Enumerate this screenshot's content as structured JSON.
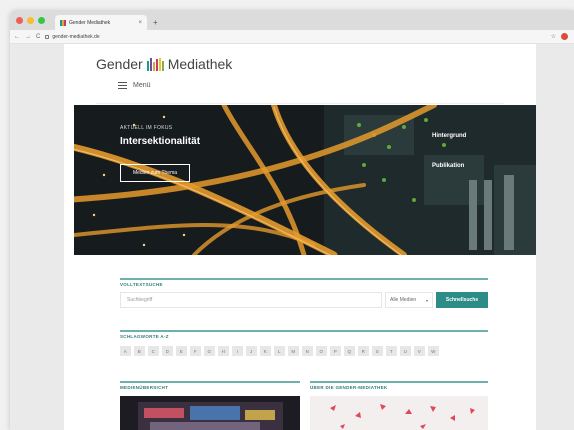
{
  "browser": {
    "tab_title": "Gender Mediathek",
    "tab_close": "×",
    "new_tab": "+",
    "url": "gender-mediathek.de",
    "nav_back": "←",
    "nav_forward": "→",
    "nav_reload": "C",
    "star": "☆",
    "traffic_lights": [
      "#ef5f57",
      "#f6bd2f",
      "#33c748"
    ]
  },
  "site": {
    "logo_left": "Gender",
    "logo_right": "Mediathek",
    "logo_bar_colors": [
      "#1c9a8f",
      "#6a4f9e",
      "#e8a03a",
      "#c0405c",
      "#f2c233",
      "#7cb342"
    ],
    "menu_label": "Menü"
  },
  "hero": {
    "kicker": "AKTUELL IM FOKUS",
    "title": "Intersektionalität",
    "button": "Medien zum Thema",
    "link1": "Hintergrund",
    "link2": "Publikation"
  },
  "search": {
    "section_label": "VOLLTEXTSUCHE",
    "placeholder": "Suchbegriff",
    "select_value": "Alle Medien",
    "button": "Schnellsuche"
  },
  "keywords": {
    "section_label": "SCHLAGWORTE A-Z",
    "letters": [
      "A",
      "B",
      "C",
      "D",
      "E",
      "F",
      "G",
      "H",
      "I",
      "J",
      "K",
      "L",
      "M",
      "N",
      "O",
      "P",
      "Q",
      "R",
      "S",
      "T",
      "U",
      "V",
      "W"
    ]
  },
  "bottom": {
    "left_label": "MEDIENÜBERSICHT",
    "right_label": "ÜBER DIE GENDER-MEDIATHEK"
  },
  "colors": {
    "accent": "#2e8c86",
    "section_rule": "#6fb0ad"
  }
}
